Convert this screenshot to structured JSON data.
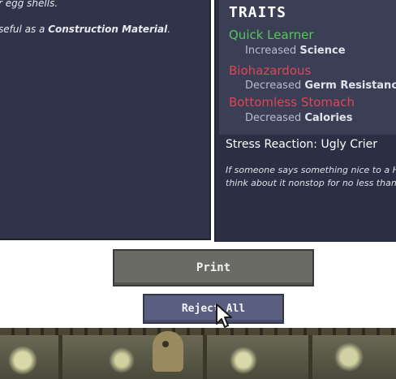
{
  "description_panel": {
    "line1": "r egg shells.",
    "line2_prefix": "seful as a ",
    "line2_bold": "Construction Material",
    "line2_suffix": "."
  },
  "traits": {
    "title": "TRAITS",
    "items": [
      {
        "name": "Quick Learner",
        "effect_prefix": "Increased ",
        "effect_stat": "Science",
        "kind": "positive",
        "color": "#56c65e"
      },
      {
        "name": "Biohazardous",
        "effect_prefix": "Decreased ",
        "effect_stat": "Germ Resistance",
        "kind": "negative",
        "color": "#e04555"
      },
      {
        "name": "Bottomless Stomach",
        "effect_prefix": "Decreased ",
        "effect_stat": "Calories",
        "kind": "negative",
        "color": "#e04555"
      }
    ]
  },
  "stress_reaction": {
    "label": "Stress Reaction: Ugly Crier",
    "quote_line1": "If someone says something nice to a H",
    "quote_line2": "think about it nonstop for no less than"
  },
  "buttons": {
    "print": "Print",
    "reject_all": "Reject All"
  },
  "icons": {
    "cursor": "mouse-pointer-icon"
  },
  "colors": {
    "panel_bg": "#2f344a",
    "print_button": "#6b6b66",
    "reject_button": "#5a5e80"
  }
}
